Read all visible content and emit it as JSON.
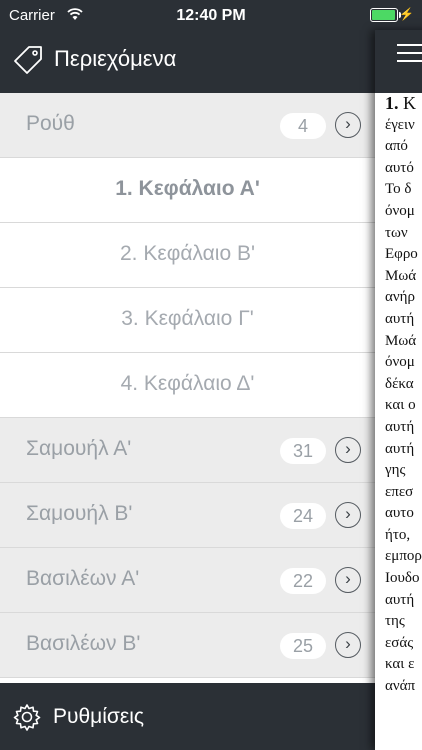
{
  "status": {
    "carrier": "Carrier",
    "time": "12:40 PM"
  },
  "drawer": {
    "title": "Περιεχόμενα",
    "settings_label": "Ρυθμίσεις",
    "rows": [
      {
        "type": "book",
        "label": "Ρούθ",
        "count": "4"
      },
      {
        "type": "chapter",
        "label": "1. Κεφάλαιο Α'",
        "active": true
      },
      {
        "type": "chapter",
        "label": "2. Κεφάλαιο Β'"
      },
      {
        "type": "chapter",
        "label": "3. Κεφάλαιο Γ'"
      },
      {
        "type": "chapter",
        "label": "4. Κεφάλαιο Δ'"
      },
      {
        "type": "book",
        "label": "Σαμουήλ Α'",
        "count": "31"
      },
      {
        "type": "book",
        "label": "Σαμουήλ Β'",
        "count": "24"
      },
      {
        "type": "book",
        "label": "Βασιλέων Α'",
        "count": "22"
      },
      {
        "type": "book",
        "label": "Βασιλέων Β'",
        "count": "25"
      }
    ]
  },
  "content": {
    "verse_number": "1.",
    "first_line": "Κ",
    "lines": [
      "έγειν",
      "από",
      "αυτό",
      "Το δ",
      "όνομ",
      "των",
      "Εφρο",
      "Μωά",
      "ανήρ",
      "αυτή",
      "Μωά",
      "όνομ",
      "δέκα",
      "και ο",
      "αυτή",
      "αυτή",
      "γης",
      "επεσ",
      "αυτο",
      "ήτο,",
      "εμπορ",
      "Ιουδο",
      "αυτή",
      "της",
      "εσάς",
      "και ε",
      "ανάπ"
    ]
  }
}
